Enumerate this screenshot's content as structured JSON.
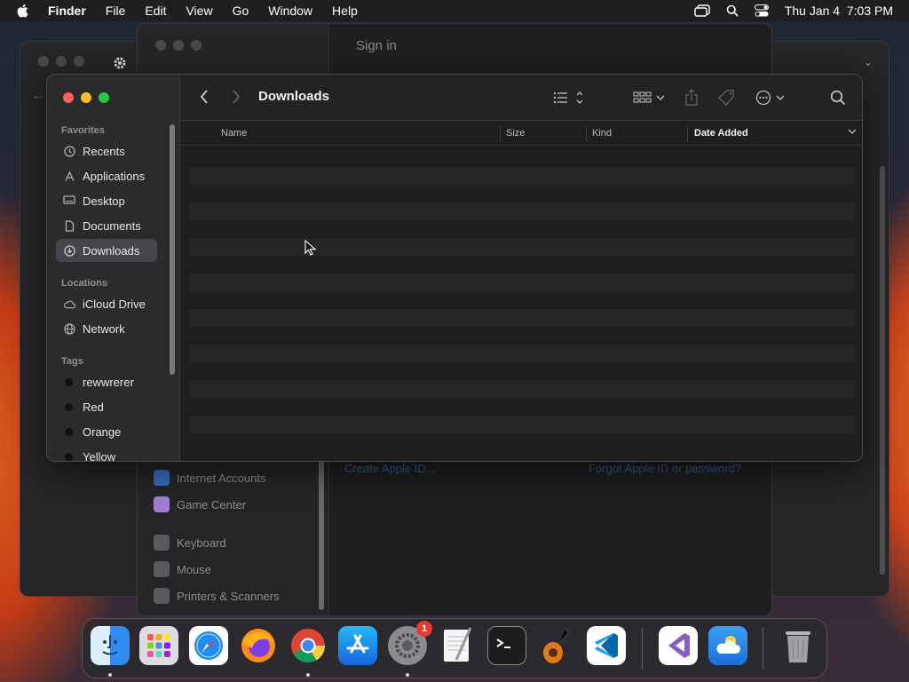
{
  "menubar": {
    "app_name": "Finder",
    "items": [
      "File",
      "Edit",
      "View",
      "Go",
      "Window",
      "Help"
    ],
    "clock": "Thu Jan 4  7:03 PM"
  },
  "background_window": {
    "title": "Sign in",
    "sidebar_items": [
      "Internet Accounts",
      "Game Center",
      "Keyboard",
      "Mouse",
      "Printers & Scanners"
    ],
    "links": {
      "create": "Create Apple ID...",
      "forgot": "Forgot Apple ID or password?"
    }
  },
  "finder": {
    "title": "Downloads",
    "sidebar": {
      "favorites_header": "Favorites",
      "favorites": [
        {
          "label": "Recents",
          "icon": "clock-icon"
        },
        {
          "label": "Applications",
          "icon": "applications-icon"
        },
        {
          "label": "Desktop",
          "icon": "desktop-icon"
        },
        {
          "label": "Documents",
          "icon": "document-icon"
        },
        {
          "label": "Downloads",
          "icon": "download-icon",
          "selected": true
        }
      ],
      "locations_header": "Locations",
      "locations": [
        {
          "label": "iCloud Drive",
          "icon": "cloud-icon"
        },
        {
          "label": "Network",
          "icon": "network-icon"
        }
      ],
      "tags_header": "Tags",
      "tags": [
        {
          "label": "rewwrerer"
        },
        {
          "label": "Red"
        },
        {
          "label": "Orange"
        },
        {
          "label": "Yellow"
        }
      ]
    },
    "columns": {
      "name": "Name",
      "size": "Size",
      "kind": "Kind",
      "date_added": "Date Added"
    },
    "sort_column": "Date Added"
  },
  "dock": {
    "apps": [
      {
        "name": "Finder",
        "icon": "finder-icon",
        "running": true
      },
      {
        "name": "Launchpad",
        "icon": "launchpad-icon",
        "running": false
      },
      {
        "name": "Safari",
        "icon": "safari-icon",
        "running": false
      },
      {
        "name": "Firefox",
        "icon": "firefox-icon",
        "running": false
      },
      {
        "name": "Chrome",
        "icon": "chrome-icon",
        "running": true
      },
      {
        "name": "App Store",
        "icon": "app-store-icon",
        "running": false
      },
      {
        "name": "System Settings",
        "icon": "system-settings-icon",
        "running": true,
        "badge": "1"
      },
      {
        "name": "TextEdit",
        "icon": "textedit-icon",
        "running": false
      },
      {
        "name": "Terminal",
        "icon": "terminal-icon",
        "running": false
      },
      {
        "name": "GarageBand",
        "icon": "garageband-icon",
        "running": false
      },
      {
        "name": "Visual Studio Code",
        "icon": "vscode-icon",
        "running": false
      },
      {
        "name": "Visual Studio",
        "icon": "visual-studio-icon",
        "running": false
      },
      {
        "name": "Weather",
        "icon": "weather-icon",
        "running": false
      },
      {
        "name": "Trash",
        "icon": "trash-icon",
        "running": false
      }
    ]
  }
}
